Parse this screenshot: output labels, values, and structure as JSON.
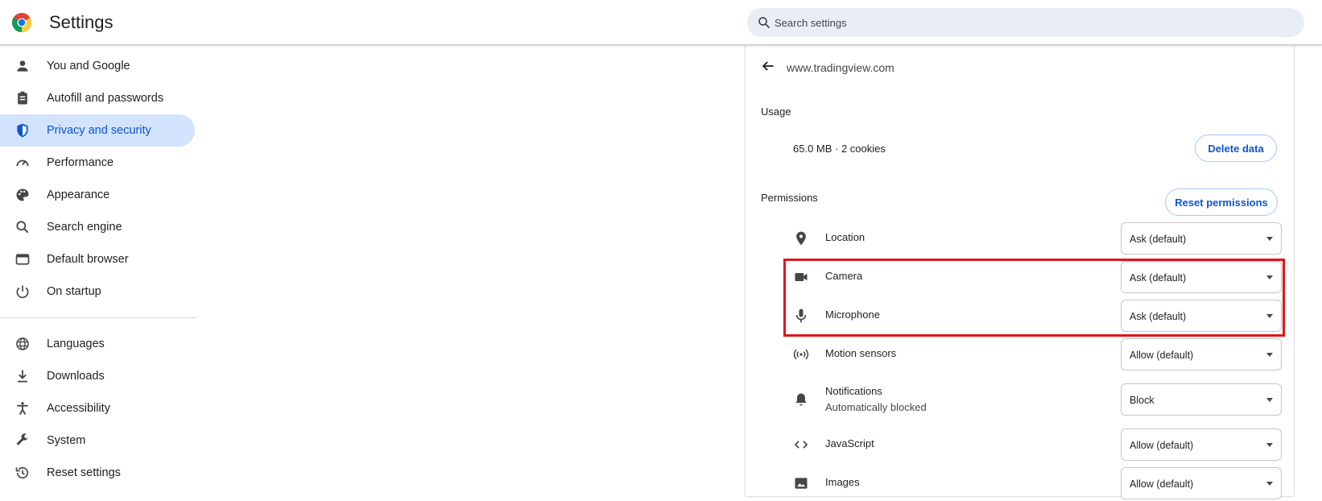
{
  "app": {
    "title": "Settings"
  },
  "search": {
    "placeholder": "Search settings"
  },
  "sidebar": {
    "items": [
      {
        "label": "You and Google",
        "icon": "person-icon"
      },
      {
        "label": "Autofill and passwords",
        "icon": "clipboard-icon"
      },
      {
        "label": "Privacy and security",
        "icon": "shield-icon",
        "active": true
      },
      {
        "label": "Performance",
        "icon": "speedometer-icon"
      },
      {
        "label": "Appearance",
        "icon": "palette-icon"
      },
      {
        "label": "Search engine",
        "icon": "search-icon"
      },
      {
        "label": "Default browser",
        "icon": "browser-window-icon"
      },
      {
        "label": "On startup",
        "icon": "power-icon"
      }
    ],
    "items2": [
      {
        "label": "Languages",
        "icon": "globe-icon"
      },
      {
        "label": "Downloads",
        "icon": "download-icon"
      },
      {
        "label": "Accessibility",
        "icon": "accessibility-icon"
      },
      {
        "label": "System",
        "icon": "wrench-icon"
      },
      {
        "label": "Reset settings",
        "icon": "history-icon"
      }
    ]
  },
  "site": {
    "title": "www.tradingview.com",
    "usage_label": "Usage",
    "usage_text": "65.0 MB · 2 cookies",
    "delete_label": "Delete data",
    "permissions_label": "Permissions",
    "reset_label": "Reset permissions"
  },
  "permissions": [
    {
      "name": "Location",
      "value": "Ask (default)",
      "icon": "location-pin-icon"
    },
    {
      "name": "Camera",
      "value": "Ask (default)",
      "icon": "camera-icon"
    },
    {
      "name": "Microphone",
      "value": "Ask (default)",
      "icon": "microphone-icon"
    },
    {
      "name": "Motion sensors",
      "value": "Allow (default)",
      "icon": "motion-sensors-icon"
    },
    {
      "name": "Notifications",
      "sub": "Automatically blocked",
      "value": "Block",
      "icon": "bell-icon"
    },
    {
      "name": "JavaScript",
      "value": "Allow (default)",
      "icon": "code-icon"
    },
    {
      "name": "Images",
      "value": "Allow (default)",
      "icon": "image-icon"
    }
  ],
  "colors": {
    "accent": "#0b57d0",
    "active_bg": "#d3e3fd",
    "highlight": "#e3131b"
  }
}
